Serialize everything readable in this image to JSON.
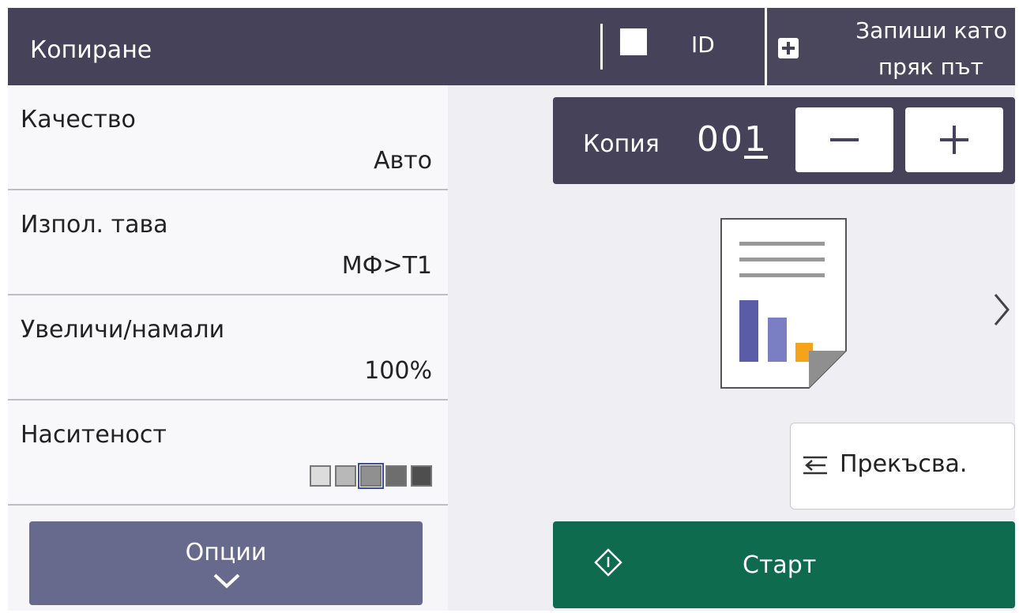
{
  "header": {
    "title": "Копиране",
    "id_label": "ID",
    "favorite_line1": "Запиши като",
    "favorite_line2": "пряк път"
  },
  "settings": [
    {
      "label": "Качество",
      "value": "Авто"
    },
    {
      "label": "Изпол. тава",
      "value": "МФ>T1"
    },
    {
      "label": "Увеличи/намали",
      "value": "100%"
    },
    {
      "label": "Наситеност",
      "density_level": 3,
      "density_max": 5
    }
  ],
  "options_label": "Опции",
  "copies": {
    "label": "Копия",
    "value_prefix": "00",
    "value_cursor": "1"
  },
  "pause_label": "Прекъсва.",
  "start_label": "Старт",
  "colors": {
    "header_bg": "#454259",
    "options_bg": "#676a8c",
    "start_bg": "#0f6b4e",
    "doc_bar_blue": "#5a5ca8",
    "doc_bar_light": "#7a7fc4",
    "doc_bar_orange": "#f4a31a"
  }
}
